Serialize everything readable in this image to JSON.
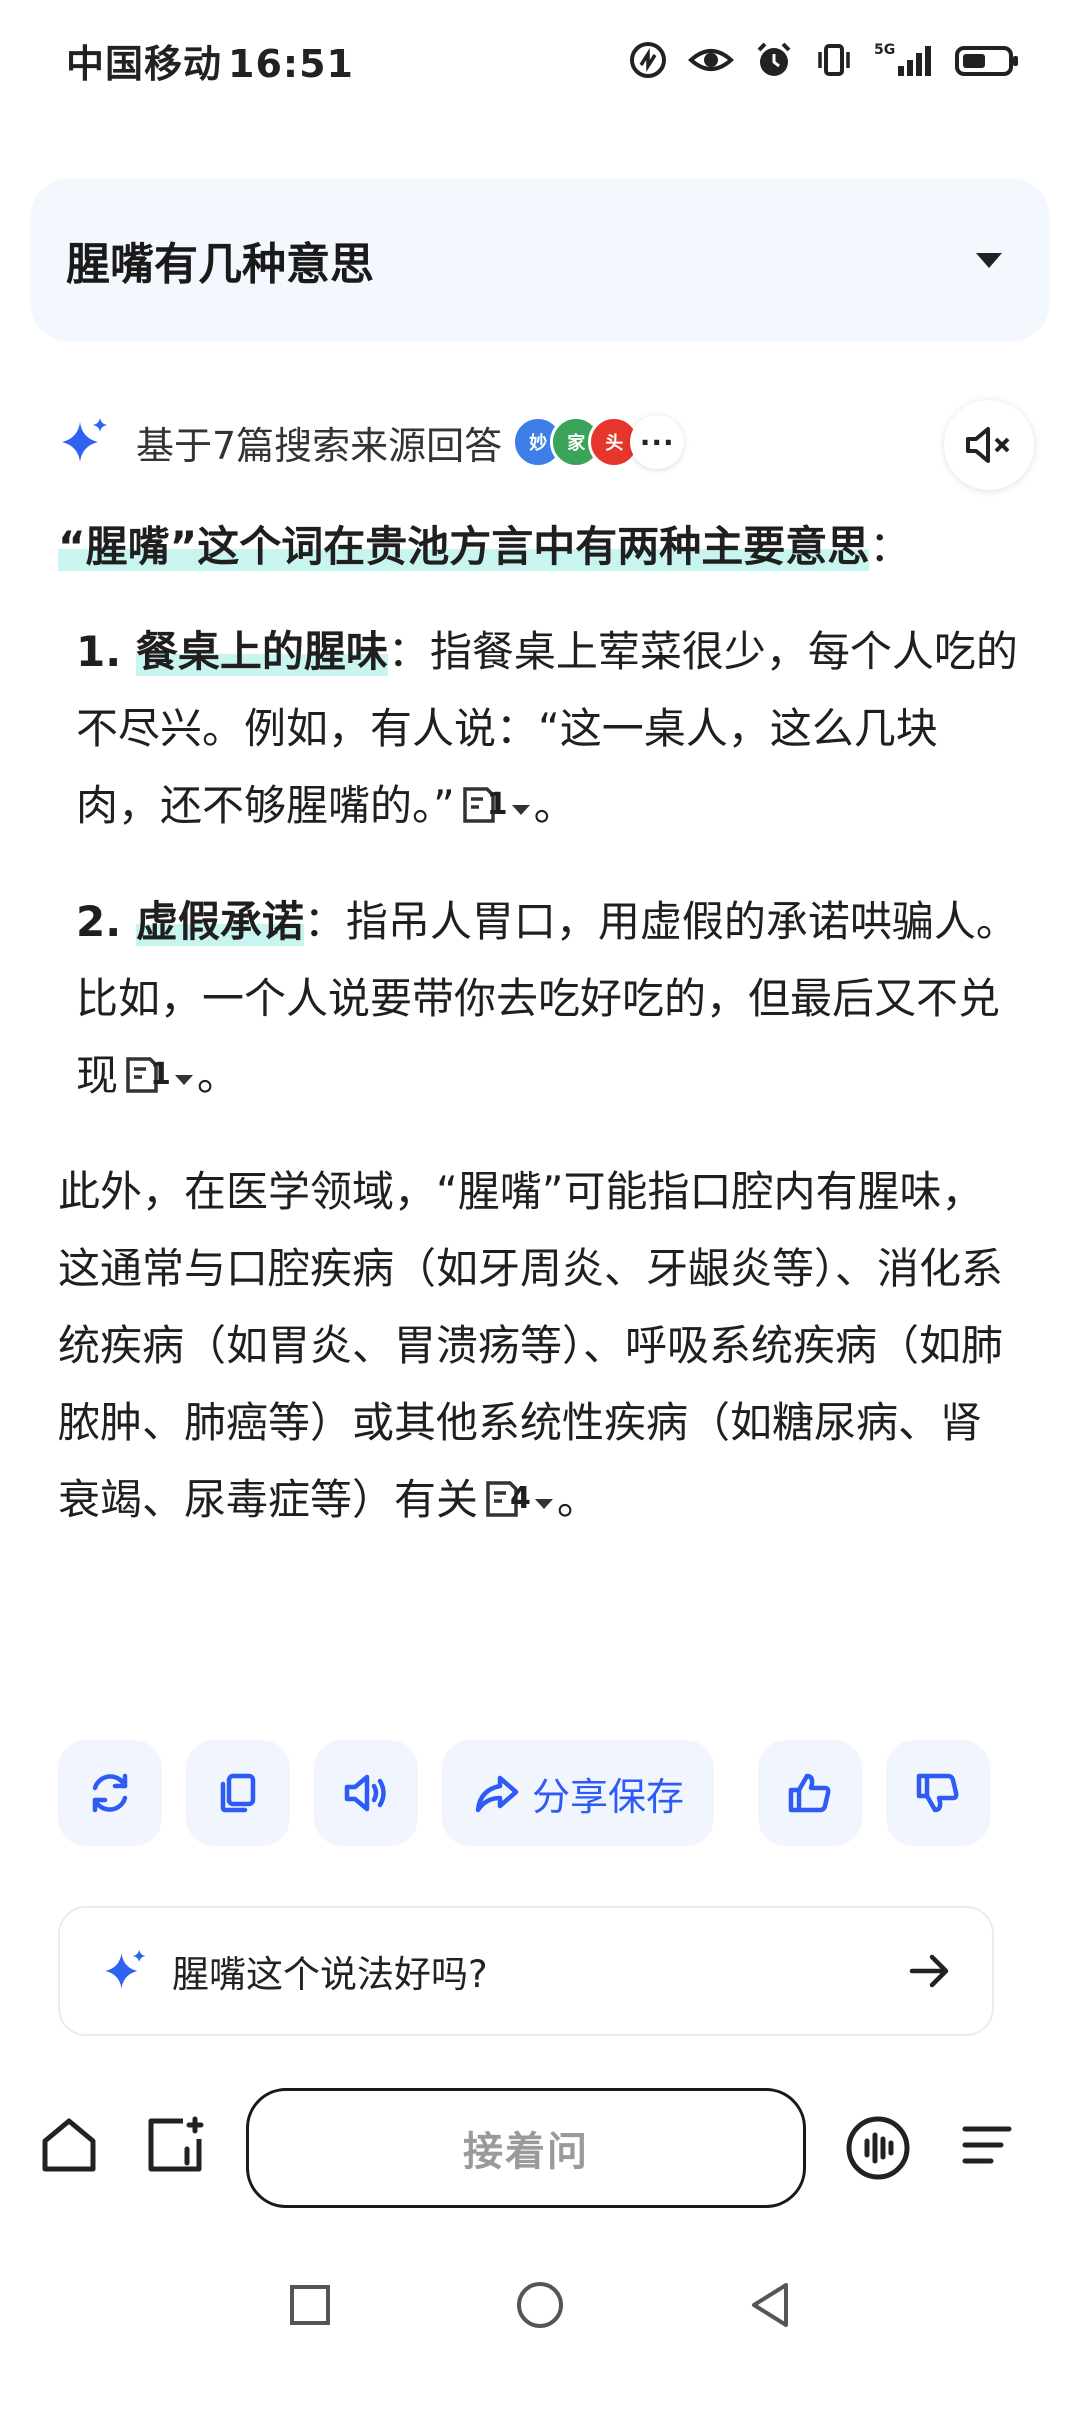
{
  "status_bar": {
    "carrier": "中国移动",
    "time": "16:51",
    "network": "5G"
  },
  "query": {
    "title": "腥嘴有几种意思"
  },
  "sources": {
    "text": "基于7篇搜索来源回答",
    "logos": [
      {
        "label": "妙",
        "color": "#3d7ee8"
      },
      {
        "label": "家",
        "color": "#3aa55a"
      },
      {
        "label": "头",
        "color": "#e6352b"
      }
    ],
    "more": "···"
  },
  "answer": {
    "lead_bold": "“腥嘴”这个词在贵池方言中有两种主要意思",
    "lead_tail": "：",
    "items": [
      {
        "num": "1. ",
        "term": "餐桌上的腥味",
        "colon": "：",
        "text": "指餐桌上荤菜很少，每个人吃的不尽兴。例如，有人说：“这一桌人，这么几块肉，还不够腥嘴的。”",
        "ref": "1",
        "end": "。"
      },
      {
        "num": "2. ",
        "term": "虚假承诺",
        "colon": "：",
        "text": "指吊人胃口，用虚假的承诺哄骗人。比如，一个人说要带你去吃好吃的，但最后又不兑现",
        "ref": "1",
        "end": "。"
      }
    ],
    "extra": {
      "text": "此外，在医学领域，“腥嘴”可能指口腔内有腥味，这通常与口腔疾病（如牙周炎、牙龈炎等）、消化系统疾病（如胃炎、胃溃疡等）、呼吸系统疾病（如肺脓肿、肺癌等）或其他系统性疾病（如糖尿病、肾衰竭、尿毒症等）有关",
      "ref": "4",
      "end": "。"
    }
  },
  "actions": {
    "share_label": "分享保存"
  },
  "suggestion": {
    "text": "腥嘴这个说法好吗?"
  },
  "bottom": {
    "ask_label": "接着问"
  }
}
